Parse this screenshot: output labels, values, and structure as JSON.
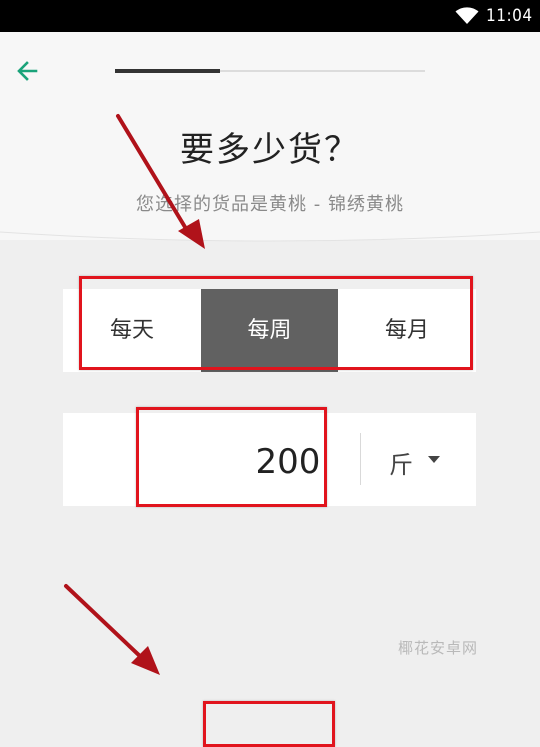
{
  "status": {
    "time": "11:04",
    "icons": [
      "wifi-icon"
    ]
  },
  "header": {
    "back_icon": "arrow-left-icon",
    "progress_fraction": 0.34,
    "title": "要多少货？",
    "subtitle": "您选择的货品是黄桃 - 锦绣黄桃"
  },
  "frequency": {
    "options": [
      "每天",
      "每周",
      "每月"
    ],
    "selected": "每周"
  },
  "quantity": {
    "value": "200",
    "unit": "斤",
    "unit_icon": "caret-down-icon"
  },
  "watermark": "椰花安卓网",
  "colors": {
    "accent": "#1aa37a",
    "selected_segment": "#616161",
    "annotation_red": "#e1141d",
    "annotation_arrow": "#b0121a"
  }
}
